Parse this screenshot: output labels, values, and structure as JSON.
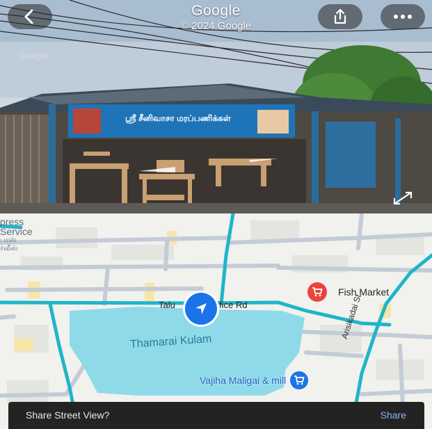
{
  "street_view": {
    "title": "Google",
    "copyright": "© 2024 Google",
    "watermark": "Google",
    "shop_sign_text": "ஸ்ரீ சீனிவாசா மரப்பணிக்கள்",
    "icons": {
      "back": "back-chevron-icon",
      "share": "share-icon",
      "more": "more-horizontal-icon",
      "expand": "expand-arrows-icon"
    }
  },
  "map": {
    "partial_labels": [
      "press",
      "Service",
      "பரஸ்",
      "ர்வீஸ்"
    ],
    "road_label": "Taluk Office Rd",
    "road_label_left": "Talu",
    "road_label_right": "fice Rd",
    "lake_name": "Thamarai Kulam",
    "places": [
      {
        "name": "Fish Market",
        "icon": "shopping-cart-icon",
        "color": "#e9443b"
      },
      {
        "name": "Vajiha Maligai & mill",
        "icon": "shopping-cart-icon",
        "color": "#1a73e8"
      }
    ],
    "street_name_vertical": "Arisikadai St",
    "colors": {
      "road": "#1fb5c9",
      "water": "#8fdae9",
      "location": "#1a73e8"
    }
  },
  "share_sheet": {
    "prompt": "Share Street View?",
    "action": "Share"
  }
}
